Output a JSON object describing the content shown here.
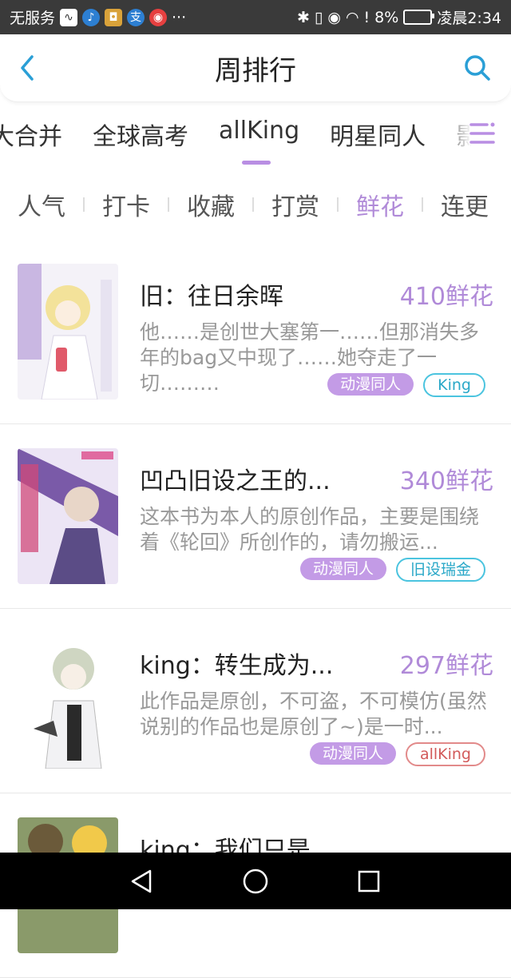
{
  "status_bar": {
    "carrier": "无服务",
    "dots": "···",
    "battery": "8%",
    "time": "凌晨2:34"
  },
  "header": {
    "title": "周排行"
  },
  "category_tabs": [
    {
      "label": "大合并",
      "active": false
    },
    {
      "label": "全球高考",
      "active": false
    },
    {
      "label": "allKing",
      "active": true
    },
    {
      "label": "明星同人",
      "active": false
    },
    {
      "label": "影",
      "active": false
    }
  ],
  "sub_tabs": [
    {
      "label": "人气",
      "active": false
    },
    {
      "label": "打卡",
      "active": false
    },
    {
      "label": "收藏",
      "active": false
    },
    {
      "label": "打赏",
      "active": false
    },
    {
      "label": "鲜花",
      "active": true
    },
    {
      "label": "连更",
      "active": false
    }
  ],
  "items": [
    {
      "title": "旧：往日余晖",
      "count": "410鲜花",
      "desc": "他……是创世大塞第一……但那消失多年的bag又中现了……她夺走了一切………",
      "tags": [
        {
          "label": "动漫同人",
          "style": "fill"
        },
        {
          "label": "King",
          "style": "outline-blue"
        }
      ]
    },
    {
      "title": "凹凸旧设之王的...",
      "count": "340鲜花",
      "desc": "这本书为本人的原创作品，主要是围绕着《轮回》所创作的，请勿搬运...",
      "tags": [
        {
          "label": "动漫同人",
          "style": "fill"
        },
        {
          "label": "旧设瑞金",
          "style": "outline-blue"
        }
      ]
    },
    {
      "title": "king：转生成为...",
      "count": "297鲜花",
      "desc": "此作品是原创，不可盗，不可模仿(虽然说别的作品也是原创了~)是一时...",
      "tags": [
        {
          "label": "动漫同人",
          "style": "fill"
        },
        {
          "label": "allKing",
          "style": "outline-red"
        }
      ]
    },
    {
      "title": "king：我们只是",
      "count": "",
      "desc": "",
      "tags": []
    }
  ],
  "colors": {
    "accent": "#b08ad8",
    "tag_fill": "#c39be6",
    "search_blue": "#2a9fd6"
  }
}
